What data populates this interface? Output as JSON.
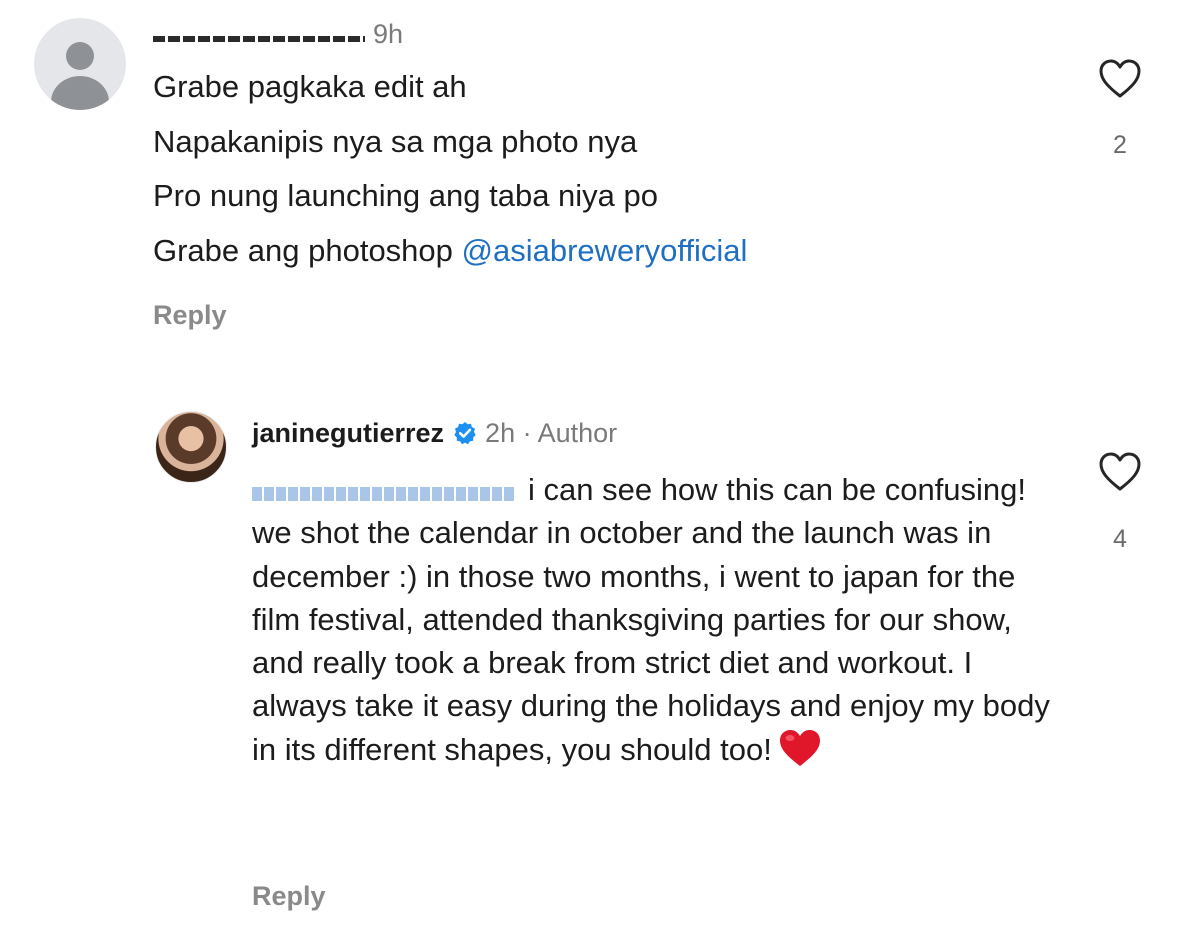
{
  "comments": [
    {
      "username": "",
      "time": "9h",
      "lines": [
        "Grabe pagkaka edit ah",
        "Napakanipis nya sa mga photo nya",
        "Pro nung launching ang taba niya po"
      ],
      "last_line_text": "Grabe ang photoshop ",
      "mention": "@asiabreweryofficial",
      "reply_label": "Reply",
      "like_count": "2"
    }
  ],
  "author_reply": {
    "username": "janinegutierrez",
    "meta": "2h · Author",
    "text": "i can see how this can be confusing! we shot the calendar in october and the launch was in december :) in those two months, i went to japan for the film festival, attended thanksgiving parties for our show, and really took a break from strict diet and workout. I always take it easy during the holidays and enjoy my body in its different shapes, you should too!",
    "emoji": "red-heart",
    "reply_label": "Reply",
    "like_count": "4"
  },
  "colors": {
    "text": "#1c1c1c",
    "muted": "#7a7a7a",
    "mention": "#1f6fc2",
    "verified": "#1d8ff0",
    "heart_emoji": "#e0162b"
  },
  "icons": [
    "default-avatar-icon",
    "heart-outline-icon",
    "verified-badge-icon",
    "red-heart-emoji"
  ]
}
